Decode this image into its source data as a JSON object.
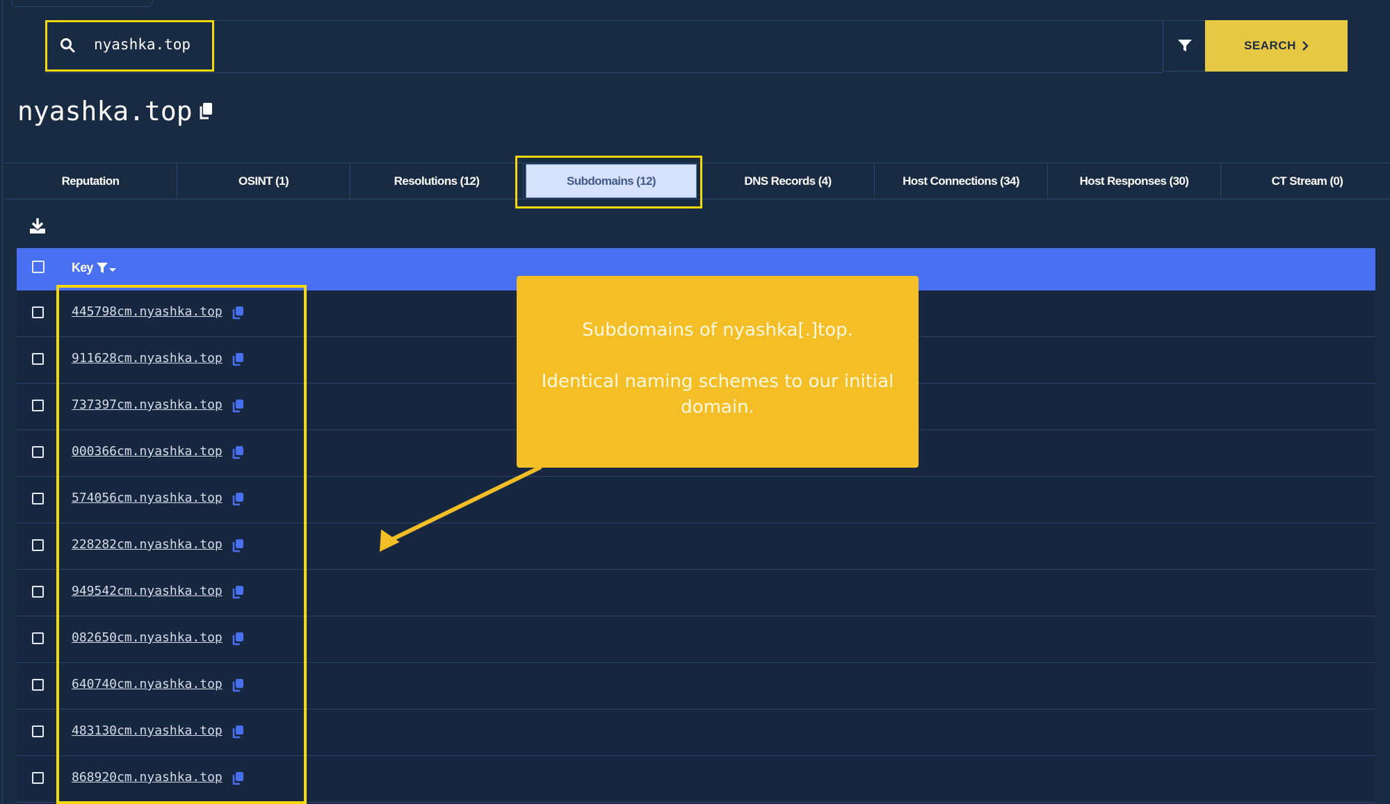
{
  "search": {
    "query": "nyashka.top",
    "button_label": "SEARCH"
  },
  "page": {
    "title": "nyashka.top"
  },
  "tabs": [
    {
      "label": "Reputation",
      "active": false
    },
    {
      "label": "OSINT (1)",
      "active": false
    },
    {
      "label": "Resolutions (12)",
      "active": false
    },
    {
      "label": "Subdomains (12)",
      "active": true
    },
    {
      "label": "DNS Records (4)",
      "active": false
    },
    {
      "label": "Host Connections (34)",
      "active": false
    },
    {
      "label": "Host Responses (30)",
      "active": false
    },
    {
      "label": "CT Stream (0)",
      "active": false
    }
  ],
  "table": {
    "column_key": "Key",
    "rows": [
      "445798cm.nyashka.top",
      "911628cm.nyashka.top",
      "737397cm.nyashka.top",
      "000366cm.nyashka.top",
      "574056cm.nyashka.top",
      "228282cm.nyashka.top",
      "949542cm.nyashka.top",
      "082650cm.nyashka.top",
      "640740cm.nyashka.top",
      "483130cm.nyashka.top",
      "868920cm.nyashka.top"
    ]
  },
  "annotation": {
    "line1": "Subdomains of nyashka[.]top.",
    "line2": "Identical naming schemes to our initial domain."
  },
  "colors": {
    "background": "#192a43",
    "accent_blue": "#4a70f2",
    "search_button": "#e6c844",
    "highlight_yellow": "#f5d90a",
    "callout": "#f3be26",
    "active_tab": "#d6e2fb"
  }
}
